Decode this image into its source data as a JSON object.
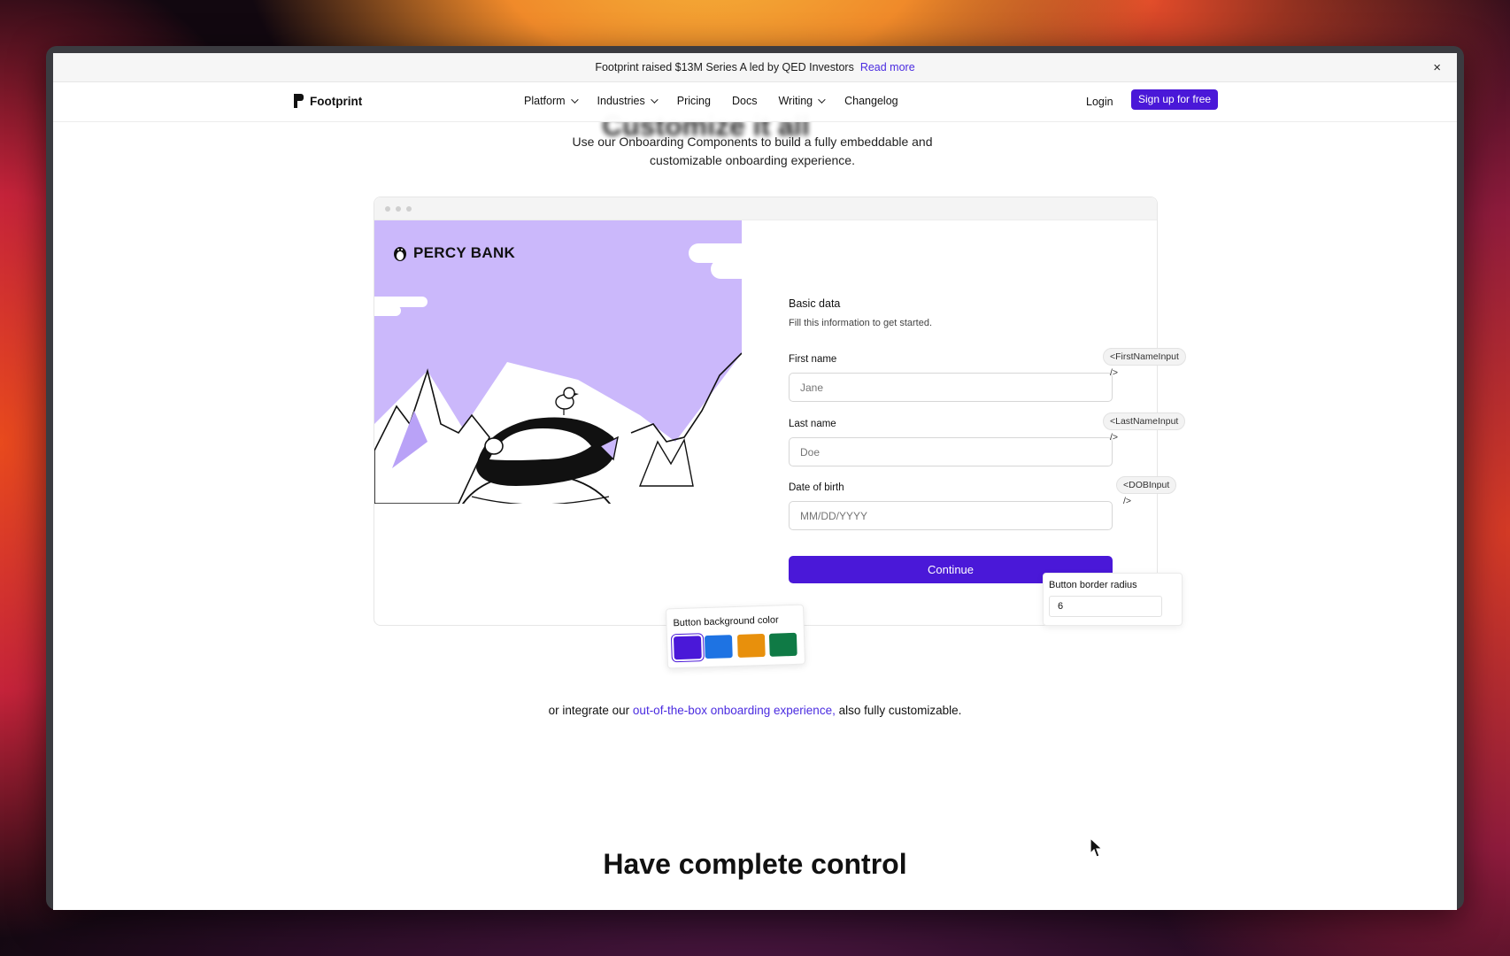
{
  "announcement": {
    "text": "Footprint raised $13M Series A led by QED Investors",
    "link": "Read more",
    "close": "×"
  },
  "nav": {
    "brand": "Footprint",
    "links": [
      "Platform",
      "Industries",
      "Pricing",
      "Docs",
      "Writing",
      "Changelog"
    ],
    "login": "Login",
    "signup": "Sign up for free"
  },
  "hero": {
    "heading_partial": "Customize it all",
    "subtitle_line1": "Use our Onboarding Components to build a fully embeddable and",
    "subtitle_line2": "customizable onboarding experience."
  },
  "demo": {
    "bank_name": "PERCY BANK",
    "form_title": "Basic data",
    "form_subtitle": "Fill this information to get started.",
    "fields": [
      {
        "label": "First name",
        "placeholder": "Jane",
        "tag": "<FirstNameInput />"
      },
      {
        "label": "Last name",
        "placeholder": "Doe",
        "tag": "<LastNameInput />"
      },
      {
        "label": "Date of birth",
        "placeholder": "MM/DD/YYYY",
        "tag": "<DOBInput />"
      }
    ],
    "continue": "Continue",
    "radius_label": "Button border radius",
    "radius_value": "6",
    "color_label": "Button background color",
    "colors": [
      "#4a18d8",
      "#1e73e3",
      "#e8900c",
      "#0f7a45"
    ]
  },
  "integrate": {
    "prefix": "or integrate our",
    "link": "out-of-the-box onboarding experience,",
    "suffix": "also fully customizable."
  },
  "section_heading": "Have complete control"
}
